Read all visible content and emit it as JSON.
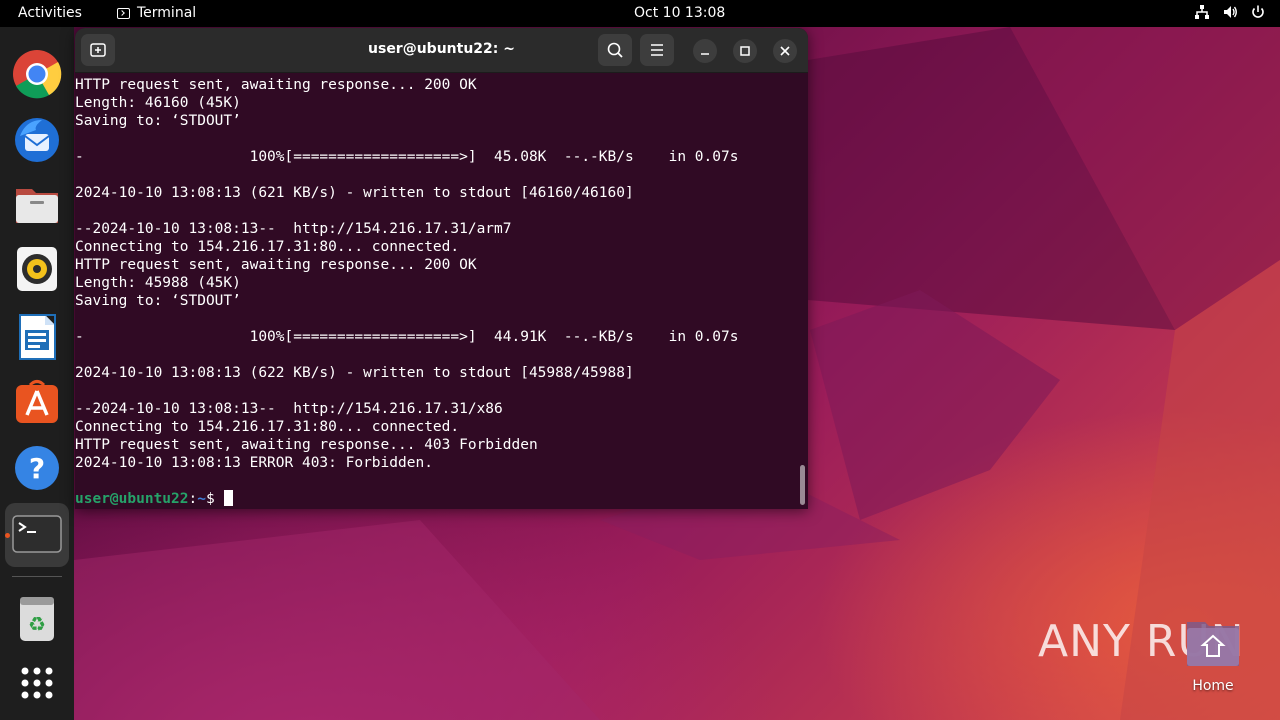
{
  "topbar": {
    "activities": "Activities",
    "app_name": "Terminal",
    "clock": "Oct 10  13:08",
    "tray_icons": [
      "network-icon",
      "volume-icon",
      "power-icon"
    ]
  },
  "dock": {
    "items": [
      {
        "name": "chrome",
        "icon": "chrome-icon"
      },
      {
        "name": "thunderbird",
        "icon": "thunderbird-icon"
      },
      {
        "name": "files",
        "icon": "files-icon"
      },
      {
        "name": "rhythmbox",
        "icon": "rhythmbox-icon"
      },
      {
        "name": "libreoffice-writer",
        "icon": "writer-icon"
      },
      {
        "name": "app-center",
        "icon": "app-center-icon"
      },
      {
        "name": "help",
        "icon": "help-icon"
      },
      {
        "name": "terminal",
        "icon": "terminal-icon",
        "running": true
      },
      {
        "name": "trash",
        "icon": "trash-icon"
      },
      {
        "name": "show-apps",
        "icon": "app-grid-icon"
      }
    ]
  },
  "terminal": {
    "title": "user@ubuntu22: ~",
    "lines": [
      "HTTP request sent, awaiting response... 200 OK",
      "Length: 46160 (45K)",
      "Saving to: ‘STDOUT’",
      "",
      "-                   100%[===================>]  45.08K  --.-KB/s    in 0.07s",
      "",
      "2024-10-10 13:08:13 (621 KB/s) - written to stdout [46160/46160]",
      "",
      "--2024-10-10 13:08:13--  http://154.216.17.31/arm7",
      "Connecting to 154.216.17.31:80... connected.",
      "HTTP request sent, awaiting response... 200 OK",
      "Length: 45988 (45K)",
      "Saving to: ‘STDOUT’",
      "",
      "-                   100%[===================>]  44.91K  --.-KB/s    in 0.07s",
      "",
      "2024-10-10 13:08:13 (622 KB/s) - written to stdout [45988/45988]",
      "",
      "--2024-10-10 13:08:13--  http://154.216.17.31/x86",
      "Connecting to 154.216.17.31:80... connected.",
      "HTTP request sent, awaiting response... 403 Forbidden",
      "2024-10-10 13:08:13 ERROR 403: Forbidden.",
      ""
    ],
    "prompt": {
      "user_host": "user@ubuntu22",
      "sep": ":",
      "path": "~",
      "symbol": "$ "
    }
  },
  "desktop": {
    "home_label": "Home",
    "watermark": "ANY RUN"
  },
  "colors": {
    "terminal_bg": "#300a24",
    "prompt_green": "#26a269",
    "prompt_blue": "#3f7fd9",
    "accent": "#e95420"
  }
}
